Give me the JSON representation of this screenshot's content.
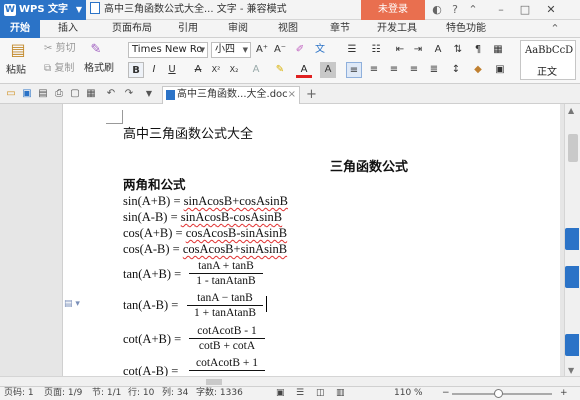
{
  "titlebar": {
    "app_name": "WPS 文字",
    "app_logo": "W",
    "doc_title": "高中三角函数公式大全... 文字 - 兼容模式",
    "login": "未登录"
  },
  "menubar": {
    "items": [
      "开始",
      "插入",
      "页面布局",
      "引用",
      "审阅",
      "视图",
      "章节",
      "开发工具",
      "特色功能"
    ]
  },
  "ribbon": {
    "paste": "粘贴",
    "cut": "剪切",
    "copy": "复制",
    "format_painter": "格式刷",
    "font_name": "Times New Ro",
    "font_size": "小四",
    "bold": "B",
    "italic": "I",
    "underline": "U",
    "strike": "A",
    "superscript": "X²",
    "subscript": "X₂",
    "font_color": "A",
    "grow_font": "A⁺",
    "shrink_font": "A⁻",
    "clear_format": "✐",
    "style_preview": "AaBbCcD",
    "style_name": "正文"
  },
  "quickbar": {
    "doc_tab": "高中三角函数...大全.doc",
    "add_tab": "+"
  },
  "document": {
    "title": "高中三角函数公式大全",
    "heading": "三角函数公式",
    "section": "两角和公式",
    "formulas": [
      {
        "lhs": "sin(A+B) = ",
        "rhs": "sinAcosB+cosAsinB"
      },
      {
        "lhs": "sin(A-B) = ",
        "rhs": "sinAcosB-cosAsinB"
      },
      {
        "lhs": "cos(A+B) = ",
        "rhs": "cosAcosB-sinAsinB"
      },
      {
        "lhs": "cos(A-B) = ",
        "rhs": "cosAcosB+sinAsinB"
      }
    ],
    "fractions": [
      {
        "lhs": "tan(A+B) = ",
        "num": "tanA  + tanB",
        "den": "1 - tanAtanB"
      },
      {
        "lhs": "tan(A-B) = ",
        "num": "tanA  − tanB",
        "den": "1 + tanAtanB"
      },
      {
        "lhs": "cot(A+B) = ",
        "num": "cotAcotB - 1",
        "den": "cotB + cotA"
      },
      {
        "lhs": "cot(A-B) = ",
        "num": "cotAcotB + 1",
        "den": ""
      }
    ]
  },
  "statusbar": {
    "page_num": "页码: 1",
    "pages": "页面: 1/9",
    "section": "节: 1/1",
    "row": "行: 10",
    "col": "列: 34",
    "words": "字数: 1336",
    "zoom": "110 %"
  },
  "colors": {
    "accent": "#2b73c7",
    "login": "#e96f4f"
  }
}
